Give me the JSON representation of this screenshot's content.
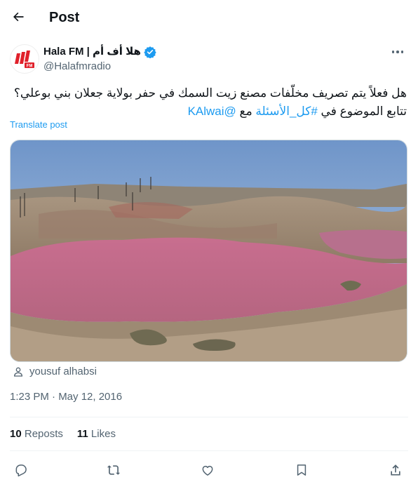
{
  "header": {
    "title": "Post",
    "back_icon": "arrow-left-icon"
  },
  "author": {
    "display_name": "Hala FM | هلا أف أم",
    "handle": "@Halafmradio",
    "verified_icon": "verified-badge-icon",
    "avatar_text": "هلا FM",
    "brand_color": "#e0202a"
  },
  "tweet": {
    "line1": "هل فعلاً يتم تصريف مخلّفات مصنع زيت السمك في حفر بولاية جعلان بني بوعلي؟",
    "line2_prefix": "تتابع الموضوع في ",
    "hashtag": "#كل_الأسئلة",
    "line2_mid": " مع ",
    "mention": "@KAlwai",
    "translate_label": "Translate post"
  },
  "media": {
    "credit_icon": "person-icon",
    "credit": "yousuf alhabsi"
  },
  "timestamp": "1:23 PM · May 12, 2016",
  "stats": {
    "reposts_count": "10",
    "reposts_label": "Reposts",
    "likes_count": "11",
    "likes_label": "Likes"
  },
  "actions": [
    "reply-icon",
    "repost-icon",
    "like-icon",
    "bookmark-icon",
    "share-icon"
  ],
  "colors": {
    "accent": "#1d9bf0",
    "text": "#0f1419",
    "muted": "#536471",
    "border": "#eff3f4"
  }
}
